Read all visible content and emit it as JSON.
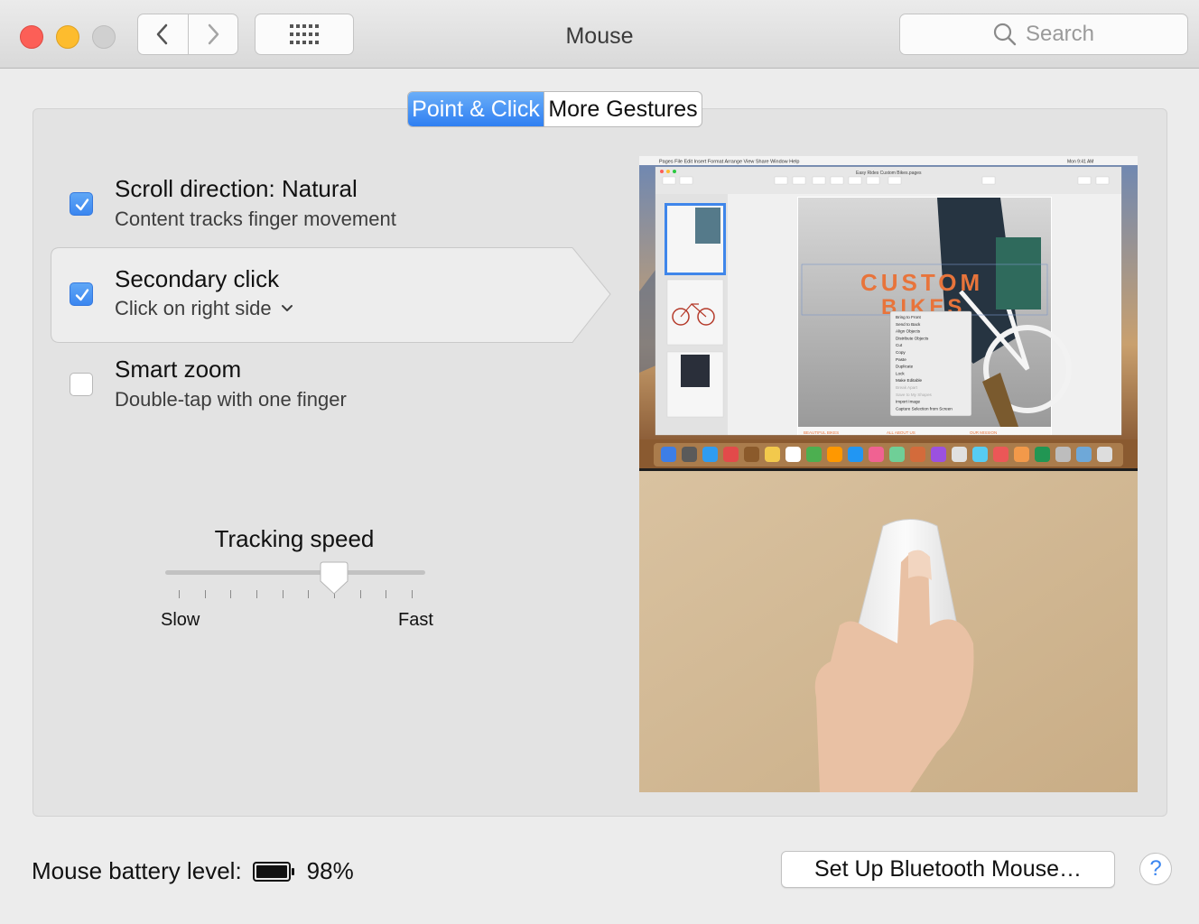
{
  "window": {
    "title": "Mouse"
  },
  "search": {
    "placeholder": "Search"
  },
  "tabs": [
    {
      "label": "Point & Click",
      "selected": true
    },
    {
      "label": "More Gestures",
      "selected": false
    }
  ],
  "options": [
    {
      "title": "Scroll direction: Natural",
      "subtitle": "Content tracks finger movement",
      "checked": true
    },
    {
      "title": "Secondary click",
      "subtitle": "Click on right side",
      "checked": true
    },
    {
      "title": "Smart zoom",
      "subtitle": "Double-tap with one finger",
      "checked": false
    }
  ],
  "tracking": {
    "title": "Tracking speed",
    "min_label": "Slow",
    "max_label": "Fast",
    "level": 0.65
  },
  "battery": {
    "label": "Mouse battery level:",
    "value": "98%"
  },
  "buttons": {
    "bluetooth": "Set Up Bluetooth Mouse…",
    "help": "?"
  },
  "preview": {
    "app_menu": [
      "Pages",
      "File",
      "Edit",
      "Insert",
      "Format",
      "Arrange",
      "View",
      "Share",
      "Window",
      "Help"
    ],
    "clock": "Mon 9:41 AM",
    "doc_title": "Easy Rides Custom Bikes.pages",
    "headline_1": "CUSTOM",
    "headline_2": "BIKES",
    "context_menu": [
      "Bring to Front",
      "Send to Back",
      "Align Objects",
      "Distribute Objects",
      "Cut",
      "Copy",
      "Paste",
      "Duplicate",
      "Lock",
      "Make Editable",
      "Break Apart",
      "Save to My Shapes",
      "Import Image",
      "Capture Selection from Screen"
    ],
    "footer_labels": [
      "BEAUTIFUL BIKES",
      "ALL ABOUT US",
      "OUR MISSION"
    ]
  },
  "colors": {
    "accent": "#3b86f0",
    "headline": "#e8743b"
  }
}
